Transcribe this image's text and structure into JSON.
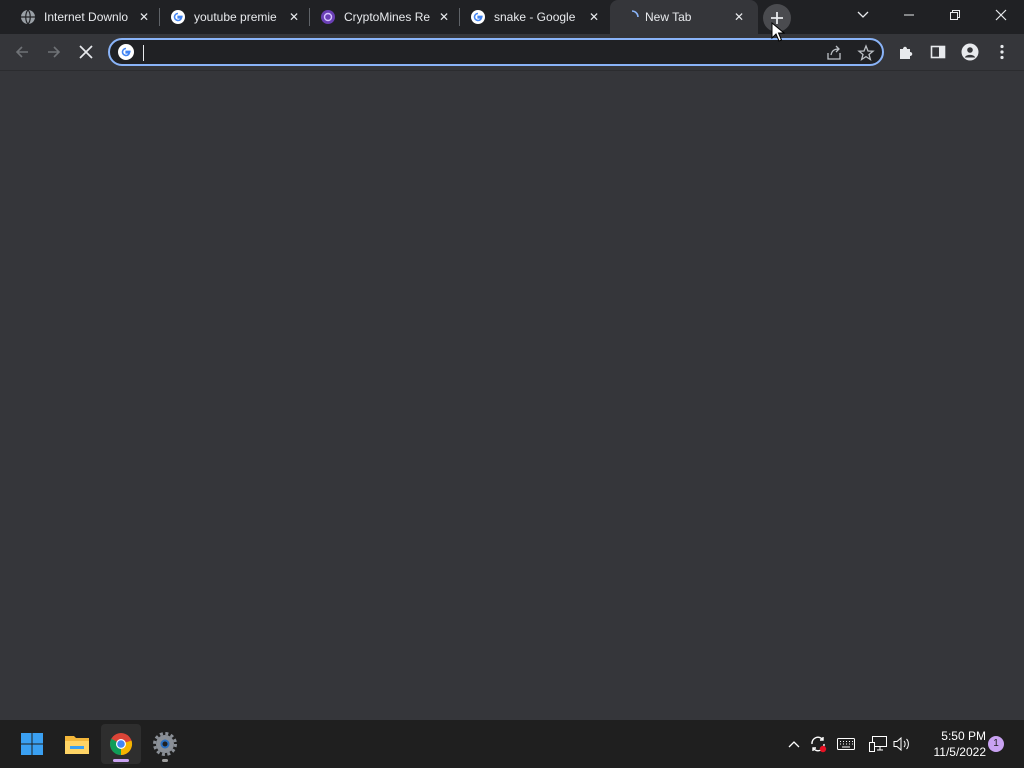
{
  "browser": {
    "tabs": [
      {
        "title": "Internet Downlo",
        "favicon": "globe-icon"
      },
      {
        "title": "youtube premie",
        "favicon": "google-icon"
      },
      {
        "title": "CryptoMines Re",
        "favicon": "cryptomines-icon"
      },
      {
        "title": "snake - Google",
        "favicon": "google-icon"
      },
      {
        "title": "New Tab",
        "favicon": "loading-spinner-icon"
      }
    ],
    "active_tab_index": 4,
    "omnibox": {
      "value": "",
      "placeholder": ""
    },
    "colors": {
      "frame": "#202124",
      "toolbar": "#35363a",
      "focus_ring": "#8ab4f8",
      "text": "#e8eaed"
    }
  },
  "taskbar": {
    "apps": [
      "windows-start-icon",
      "file-explorer-icon",
      "chrome-icon",
      "settings-icon"
    ],
    "clock": {
      "time": "5:50 PM",
      "date": "11/5/2022"
    },
    "notification_count": "1"
  }
}
